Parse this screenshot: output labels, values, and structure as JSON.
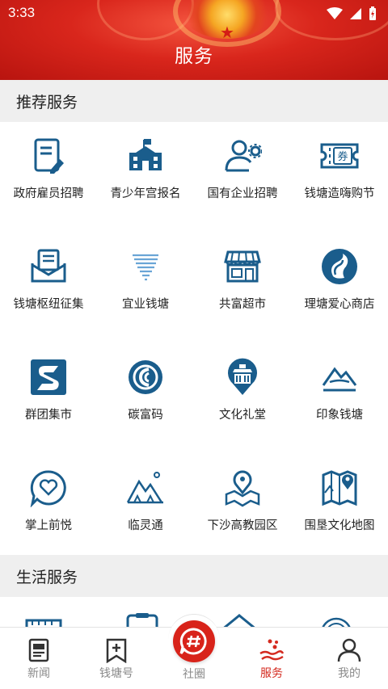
{
  "status": {
    "time": "3:33"
  },
  "header": {
    "title": "服务"
  },
  "sections": {
    "recommended": "推荐服务",
    "life": "生活服务"
  },
  "recommended_items": [
    {
      "label": "政府雇员招聘",
      "icon": "document-pen-icon"
    },
    {
      "label": "青少年宫报名",
      "icon": "school-building-icon"
    },
    {
      "label": "国有企业招聘",
      "icon": "user-gear-icon"
    },
    {
      "label": "钱塘造嗨购节",
      "icon": "coupon-ticket-icon"
    },
    {
      "label": "钱塘枢纽征集",
      "icon": "mail-envelope-icon"
    },
    {
      "label": "宜业钱塘",
      "icon": "wave-lines-icon"
    },
    {
      "label": "共富超市",
      "icon": "storefront-icon"
    },
    {
      "label": "理塘爱心商店",
      "icon": "swirl-logo-icon"
    },
    {
      "label": "群团集市",
      "icon": "s-logo-icon"
    },
    {
      "label": "碳富码",
      "icon": "carbon-code-icon"
    },
    {
      "label": "文化礼堂",
      "icon": "hall-pin-icon"
    },
    {
      "label": "印象钱塘",
      "icon": "mountain-sketch-icon"
    },
    {
      "label": "掌上前悦",
      "icon": "heart-bubble-icon"
    },
    {
      "label": "临灵通",
      "icon": "mountain-sun-icon"
    },
    {
      "label": "下沙高教园区",
      "icon": "map-pin-icon"
    },
    {
      "label": "围垦文化地图",
      "icon": "folded-map-icon"
    }
  ],
  "tabs": [
    {
      "label": "新闻",
      "icon": "newspaper-icon",
      "active": false
    },
    {
      "label": "钱塘号",
      "icon": "bookmark-plus-icon",
      "active": false
    },
    {
      "label": "社圈",
      "icon": "hashtag-bubble-icon",
      "active": false
    },
    {
      "label": "服务",
      "icon": "service-hand-icon",
      "active": true
    },
    {
      "label": "我的",
      "icon": "person-icon",
      "active": false
    }
  ],
  "colors": {
    "accent": "#d8231a",
    "icon_blue": "#1a5d8c",
    "section_bg": "#efefef"
  }
}
